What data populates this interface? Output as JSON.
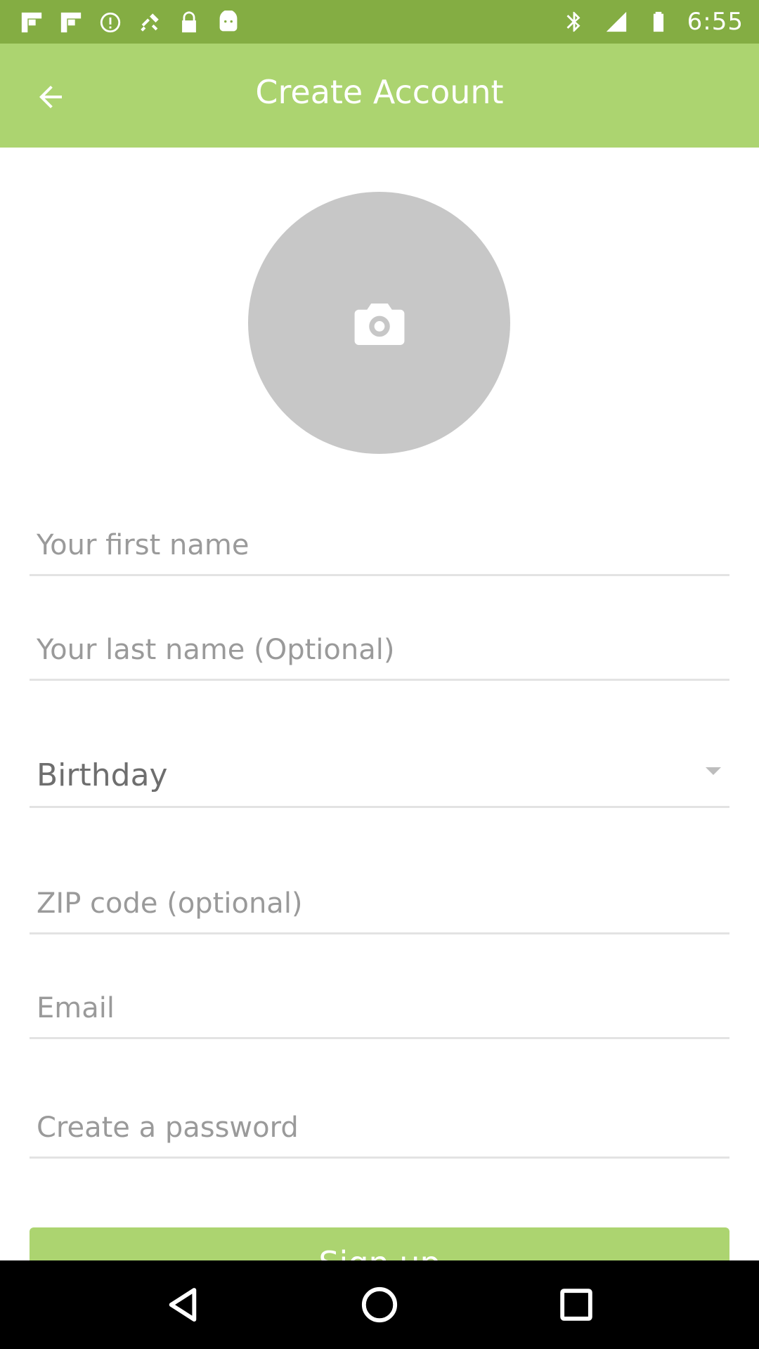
{
  "status_bar": {
    "time": "6:55",
    "left_icons": [
      "flipboard-icon",
      "flipboard-icon",
      "alert-icon",
      "fake-gps-icon",
      "lock-icon",
      "android-icon"
    ],
    "right_icons": [
      "bluetooth-icon",
      "signal-icon",
      "battery-icon"
    ]
  },
  "app_bar": {
    "title": "Create Account",
    "back_icon": "arrow-back-icon"
  },
  "avatar": {
    "icon": "camera-icon"
  },
  "form": {
    "first_name_placeholder": "Your first name",
    "last_name_placeholder": "Your last name (Optional)",
    "birthday_label": "Birthday",
    "zip_placeholder": "ZIP code (optional)",
    "email_placeholder": "Email",
    "password_placeholder": "Create a password",
    "signup_label": "Sign up"
  },
  "nav_bar": {
    "back": "nav-back-icon",
    "home": "nav-home-icon",
    "recents": "nav-recents-icon"
  },
  "colors": {
    "status_bar": "#84ad43",
    "app_bar": "#acd470",
    "avatar": "#c7c7c7",
    "divider": "#e3e3e3",
    "button": "#acd470"
  }
}
